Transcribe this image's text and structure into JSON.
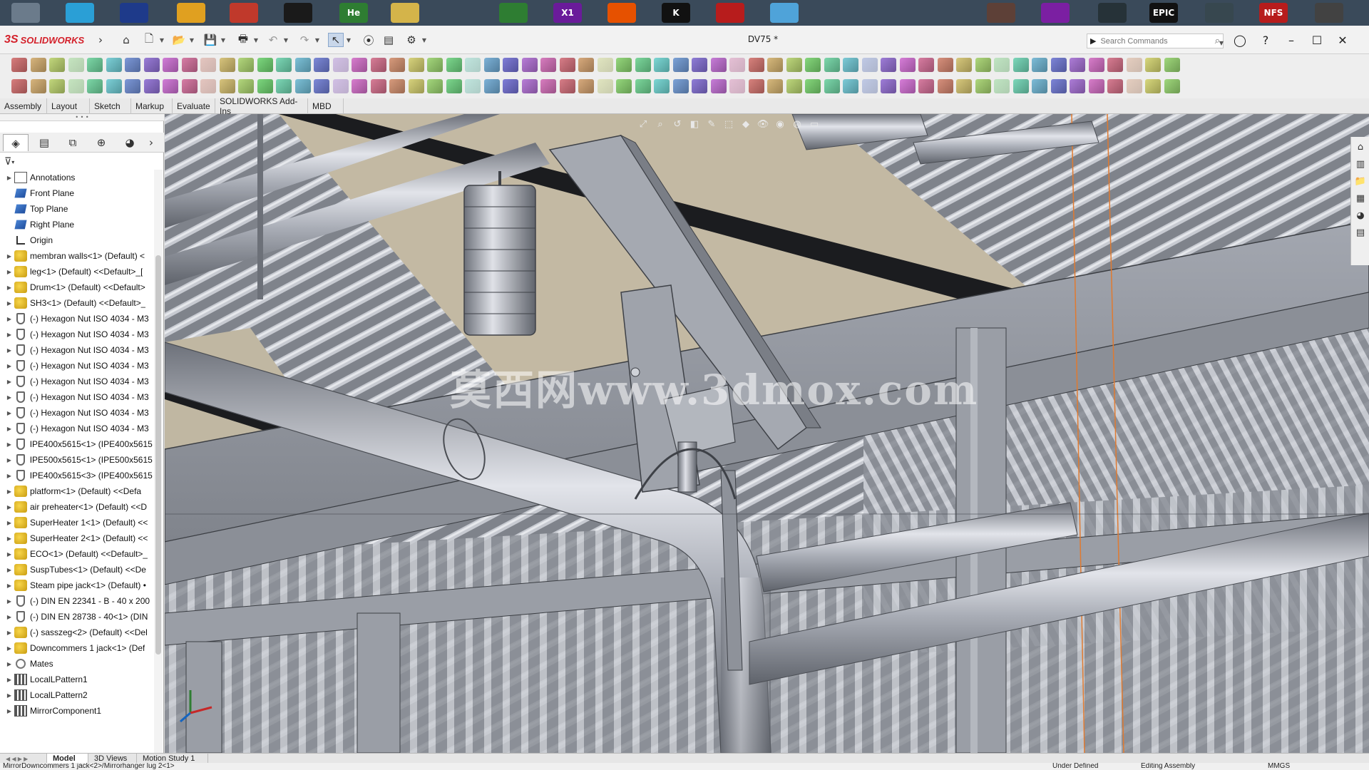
{
  "app": {
    "brand": "SOLIDWORKS",
    "document_title": "DV75 *"
  },
  "taskbar": {
    "icons": [
      {
        "name": "folder-app-icon",
        "label": "",
        "color": "#6b7b8b"
      },
      {
        "name": "window-app-icon",
        "label": "",
        "color": "#2a9fd6"
      },
      {
        "name": "floppy-app-icon",
        "label": "",
        "color": "#1e3a8a"
      },
      {
        "name": "gear-app-icon",
        "label": "",
        "color": "#e0a020"
      },
      {
        "name": "arrow-app-icon",
        "label": "",
        "color": "#c0392b"
      },
      {
        "name": "speedometer-app-icon",
        "label": "",
        "color": "#1a1a1a"
      },
      {
        "name": "he-app-icon",
        "label": "He",
        "color": "#2e7d32"
      },
      {
        "name": "disc-app-icon",
        "label": "",
        "color": "#d4b44a"
      },
      {
        "name": "xbox-app-icon",
        "label": "",
        "color": "#2e7d32"
      },
      {
        "name": "precision-app-icon",
        "label": "X1",
        "color": "#6a1b9a"
      },
      {
        "name": "fire-app-icon",
        "label": "",
        "color": "#e65100"
      },
      {
        "name": "k-app-icon",
        "label": "K",
        "color": "#111111"
      },
      {
        "name": "car-app-icon",
        "label": "",
        "color": "#b71c1c"
      },
      {
        "name": "steam-like-app-icon",
        "label": "",
        "color": "#4fa3d9"
      },
      {
        "name": "game-thumb-app-icon",
        "label": "",
        "color": "#5d4037"
      },
      {
        "name": "ring-app-icon",
        "label": "",
        "color": "#7b1fa2"
      },
      {
        "name": "steam-app-icon",
        "label": "",
        "color": "#263238"
      },
      {
        "name": "epic-app-icon",
        "label": "EPIC",
        "color": "#111111"
      },
      {
        "name": "game-thumb2-app-icon",
        "label": "",
        "color": "#37474f"
      },
      {
        "name": "nfs-app-icon",
        "label": "NFS",
        "color": "#b71c1c"
      },
      {
        "name": "game-thumb3-app-icon",
        "label": "",
        "color": "#424242"
      }
    ]
  },
  "search": {
    "placeholder": "Search Commands"
  },
  "command_tabs": [
    "Assembly",
    "Layout",
    "Sketch",
    "Markup",
    "Evaluate",
    "SOLIDWORKS Add-Ins",
    "MBD"
  ],
  "feature_tree": {
    "items": [
      {
        "label": "Annotations",
        "icon": "annotations"
      },
      {
        "label": "Front Plane",
        "icon": "plane"
      },
      {
        "label": "Top Plane",
        "icon": "plane"
      },
      {
        "label": "Right Plane",
        "icon": "plane"
      },
      {
        "label": "Origin",
        "icon": "origin"
      },
      {
        "label": "membran walls<1> (Default) <",
        "icon": "assembly"
      },
      {
        "label": "leg<1> (Default) <<Default>_[",
        "icon": "assembly"
      },
      {
        "label": "Drum<1> (Default) <<Default>",
        "icon": "assembly"
      },
      {
        "label": "SH3<1> (Default) <<Default>_",
        "icon": "assembly"
      },
      {
        "label": "(-) Hexagon Nut ISO 4034 - M3",
        "icon": "part"
      },
      {
        "label": "(-) Hexagon Nut ISO 4034 - M3",
        "icon": "part"
      },
      {
        "label": "(-) Hexagon Nut ISO 4034 - M3",
        "icon": "part"
      },
      {
        "label": "(-) Hexagon Nut ISO 4034 - M3",
        "icon": "part"
      },
      {
        "label": "(-) Hexagon Nut ISO 4034 - M3",
        "icon": "part"
      },
      {
        "label": "(-) Hexagon Nut ISO 4034 - M3",
        "icon": "part"
      },
      {
        "label": "(-) Hexagon Nut ISO 4034 - M3",
        "icon": "part"
      },
      {
        "label": "(-) Hexagon Nut ISO 4034 - M3",
        "icon": "part"
      },
      {
        "label": "IPE400x5615<1> (IPE400x5615)",
        "icon": "part"
      },
      {
        "label": "IPE500x5615<1> (IPE500x5615)",
        "icon": "part"
      },
      {
        "label": "IPE400x5615<3> (IPE400x5615)",
        "icon": "part"
      },
      {
        "label": "platform<1> (Default) <<Defa",
        "icon": "assembly"
      },
      {
        "label": "air preheater<1> (Default) <<D",
        "icon": "assembly"
      },
      {
        "label": "SuperHeater 1<1> (Default) <<",
        "icon": "assembly"
      },
      {
        "label": "SuperHeater 2<1> (Default) <<",
        "icon": "assembly"
      },
      {
        "label": "ECO<1> (Default) <<Default>_",
        "icon": "assembly"
      },
      {
        "label": "SuspTubes<1> (Default) <<De",
        "icon": "assembly"
      },
      {
        "label": "Steam pipe jack<1> (Default) •",
        "icon": "assembly"
      },
      {
        "label": "(-) DIN EN 22341 - B - 40 x 200",
        "icon": "part"
      },
      {
        "label": "(-) DIN EN 28738 - 40<1> (DIN",
        "icon": "part"
      },
      {
        "label": "(-) sasszeg<2> (Default) <<Del",
        "icon": "assembly"
      },
      {
        "label": "Downcommers 1 jack<1> (Def",
        "icon": "assembly"
      },
      {
        "label": "Mates",
        "icon": "mates"
      },
      {
        "label": "LocalLPattern1",
        "icon": "pattern"
      },
      {
        "label": "LocalLPattern2",
        "icon": "pattern"
      },
      {
        "label": "MirrorComponent1",
        "icon": "pattern"
      }
    ]
  },
  "viewport": {
    "watermark": "莫西网www.3dmox.com"
  },
  "bottom_tabs": [
    "Model",
    "3D Views",
    "Motion Study 1"
  ],
  "status": {
    "path": "MirrorDowncommers 1 jack<2>/Mirrorhanger lug 2<1>",
    "state": "Under Defined",
    "mode": "Editing Assembly",
    "units": "MMGS"
  },
  "colors": {
    "accent": "#d4202a",
    "viewport_bg": "#7c7f86",
    "steel": "#9ea2ab"
  }
}
